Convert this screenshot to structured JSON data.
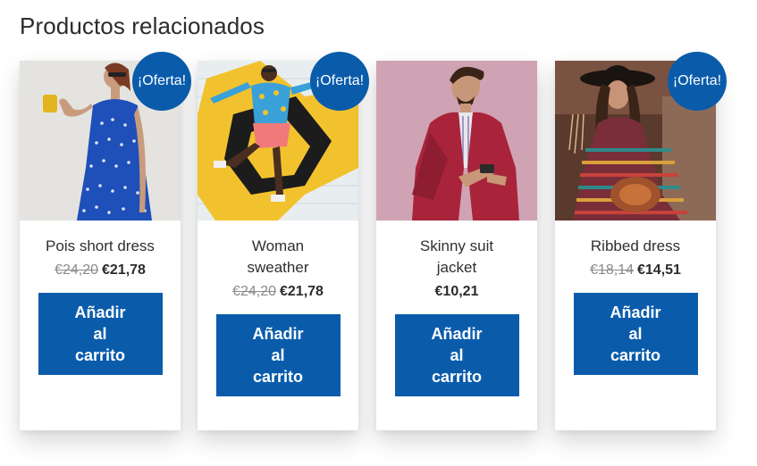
{
  "section": {
    "title": "Productos relacionados"
  },
  "badge": {
    "label": "¡Oferta!",
    "color": "#0a5cab"
  },
  "button": {
    "label": "Añadir\nal\ncarrito",
    "color": "#0a5cab"
  },
  "products": [
    {
      "name": "Pois short dress",
      "old_price": "€24,20",
      "price": "€21,78",
      "on_sale": true
    },
    {
      "name": "Woman\nsweather",
      "old_price": "€24,20",
      "price": "€21,78",
      "on_sale": true
    },
    {
      "name": "Skinny suit\njacket",
      "old_price": "",
      "price": "€10,21",
      "on_sale": false
    },
    {
      "name": "Ribbed dress",
      "old_price": "€18,14",
      "price": "€14,51",
      "on_sale": true
    }
  ]
}
